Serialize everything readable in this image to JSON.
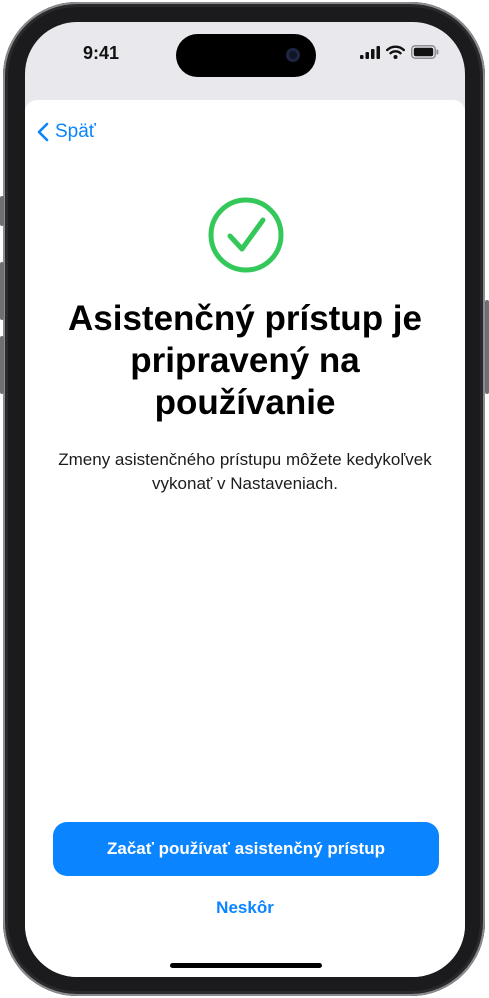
{
  "status_bar": {
    "time": "9:41",
    "icons": [
      "cellular-signal-icon",
      "wifi-icon",
      "battery-icon"
    ]
  },
  "nav": {
    "back_label": "Späť",
    "back_icon": "chevron-left-icon"
  },
  "content": {
    "icon": "checkmark-circle-icon",
    "title": "Asistenčný prístup je pripravený na používanie",
    "subtitle": "Zmeny asistenčného prístupu môžete kedykoľvek vykonať v Nastaveniach."
  },
  "actions": {
    "primary_label": "Začať používať asistenčný prístup",
    "secondary_label": "Neskôr"
  },
  "colors": {
    "accent": "#0A84FF",
    "success": "#34C759"
  }
}
